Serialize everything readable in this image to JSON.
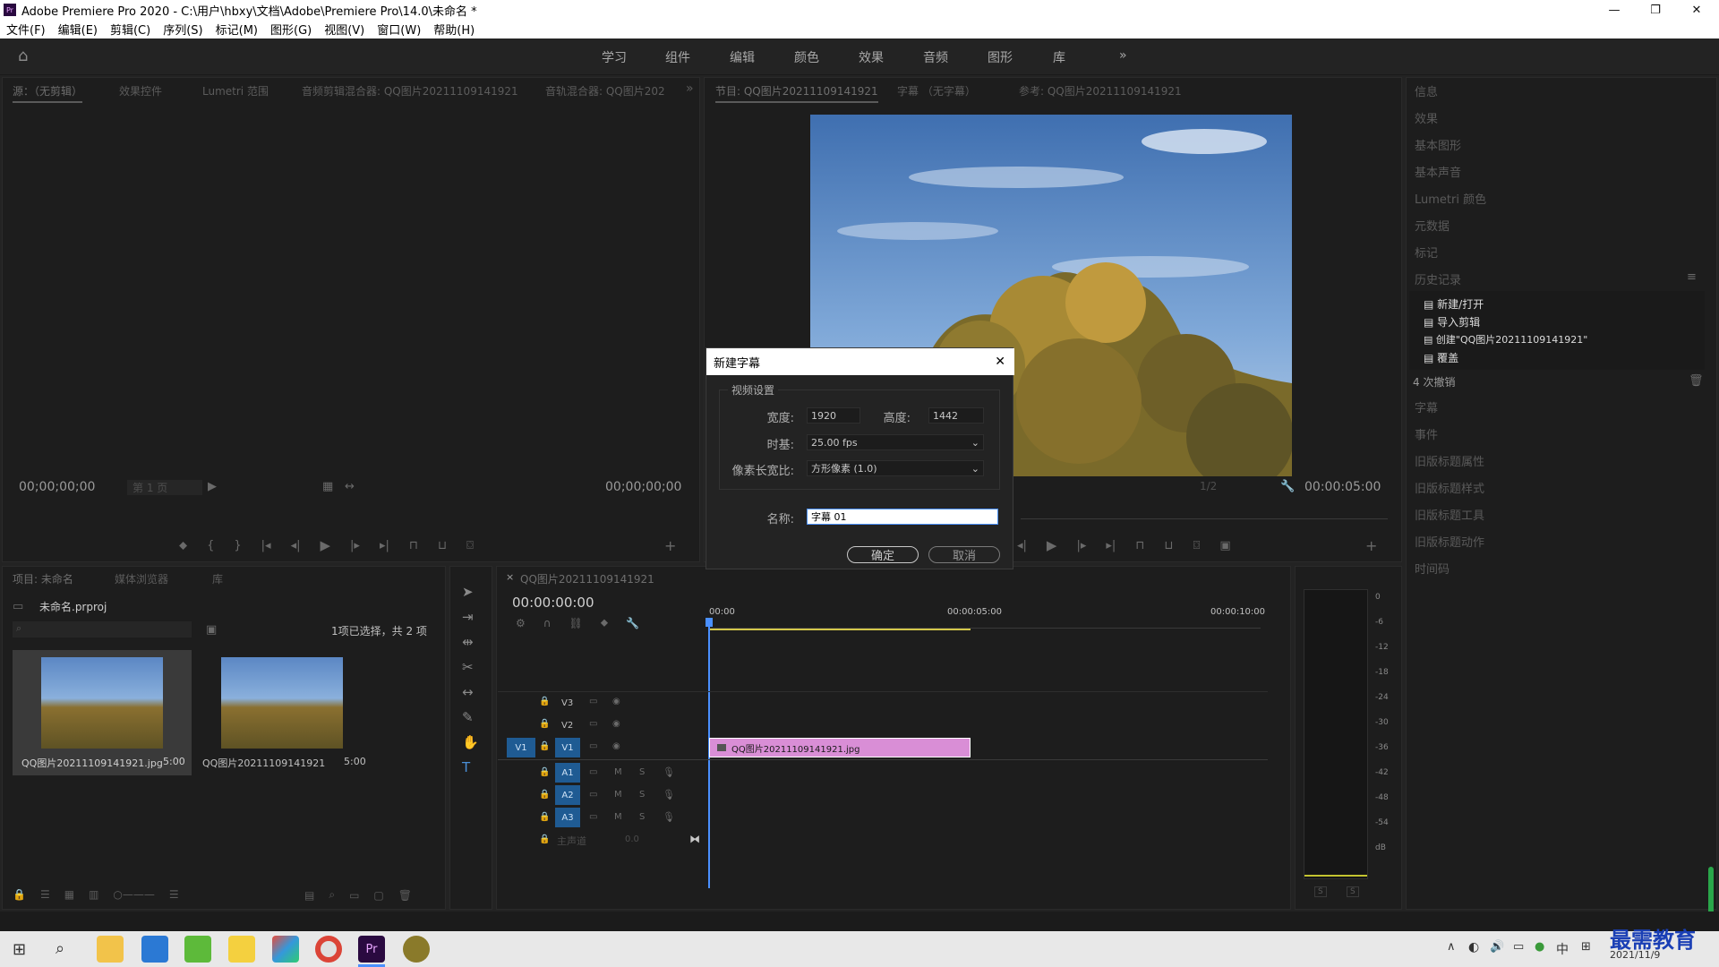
{
  "window": {
    "title": "Adobe Premiere Pro 2020 - C:\\用户\\hbxy\\文档\\Adobe\\Premiere Pro\\14.0\\未命名 *"
  },
  "menu": [
    "文件(F)",
    "编辑(E)",
    "剪辑(C)",
    "序列(S)",
    "标记(M)",
    "图形(G)",
    "视图(V)",
    "窗口(W)",
    "帮助(H)"
  ],
  "workspaces": [
    "学习",
    "组件",
    "编辑",
    "颜色",
    "效果",
    "音频",
    "图形",
    "库"
  ],
  "source_tabs": [
    "源：（无剪辑）",
    "效果控件",
    "Lumetri 范围",
    "音频剪辑混合器: QQ图片20211109141921",
    "音轨混合器: QQ图片202"
  ],
  "source": {
    "tc_left": "00;00;00;00",
    "page": "第 1 页",
    "tc_right": "00;00;00;00"
  },
  "program_tabs": [
    "节目: QQ图片20211109141921",
    "字幕 （无字幕）",
    "参考: QQ图片20211109141921"
  ],
  "program": {
    "zoom": "1/2",
    "tc": "00:00:05:00"
  },
  "right_panel": {
    "items_top": [
      "信息",
      "效果",
      "基本图形",
      "基本声音",
      "Lumetri 颜色",
      "元数据",
      "标记",
      "历史记录"
    ],
    "history": [
      "新建/打开",
      "导入剪辑",
      "创建\"QQ图片20211109141921\"",
      "覆盖"
    ],
    "undo_count": "4 次撤销",
    "items_bottom": [
      "字幕",
      "事件",
      "旧版标题属性",
      "旧版标题样式",
      "旧版标题工具",
      "旧版标题动作",
      "时间码"
    ]
  },
  "project": {
    "tabs": [
      "项目: 未命名",
      "媒体浏览器",
      "库"
    ],
    "file": "未命名.prproj",
    "selection": "1项已选择，共 2 项",
    "items": [
      {
        "name": "QQ图片20211109141921.jpg",
        "dur": "5:00"
      },
      {
        "name": "QQ图片20211109141921",
        "dur": "5:00"
      }
    ]
  },
  "timeline": {
    "tab": "QQ图片20211109141921",
    "tc": "00:00:00:00",
    "ruler": [
      "00:00",
      "00:00:05:00",
      "00:00:10:00"
    ],
    "video_tracks": [
      "V3",
      "V2",
      "V1"
    ],
    "src_v": "V1",
    "audio_tracks": [
      "A1",
      "A2",
      "A3"
    ],
    "master": "主声道",
    "master_val": "0.0",
    "clip": "QQ图片20211109141921.jpg",
    "clip_color": "#d98ed6"
  },
  "meter": {
    "scale": [
      "0",
      "-6",
      "-12",
      "-18",
      "-24",
      "-30",
      "-36",
      "-42",
      "-48",
      "-54",
      "dB"
    ],
    "s_labels": [
      "S",
      "S"
    ]
  },
  "dialog": {
    "title": "新建字幕",
    "group": "视频设置",
    "width_label": "宽度:",
    "width": "1920",
    "height_label": "高度:",
    "height": "1442",
    "timebase_label": "时基:",
    "timebase": "25.00 fps",
    "par_label": "像素长宽比:",
    "par": "方形像素 (1.0)",
    "name_label": "名称:",
    "name": "字幕 01",
    "ok": "确定",
    "cancel": "取消"
  },
  "taskbar": {
    "tray": "中",
    "date": "2021/11/9",
    "watermark": "最需教育"
  },
  "colors": {
    "accent": "#2d8ceb",
    "clip": "#d98ed6",
    "playhead": "#4a90ff"
  }
}
